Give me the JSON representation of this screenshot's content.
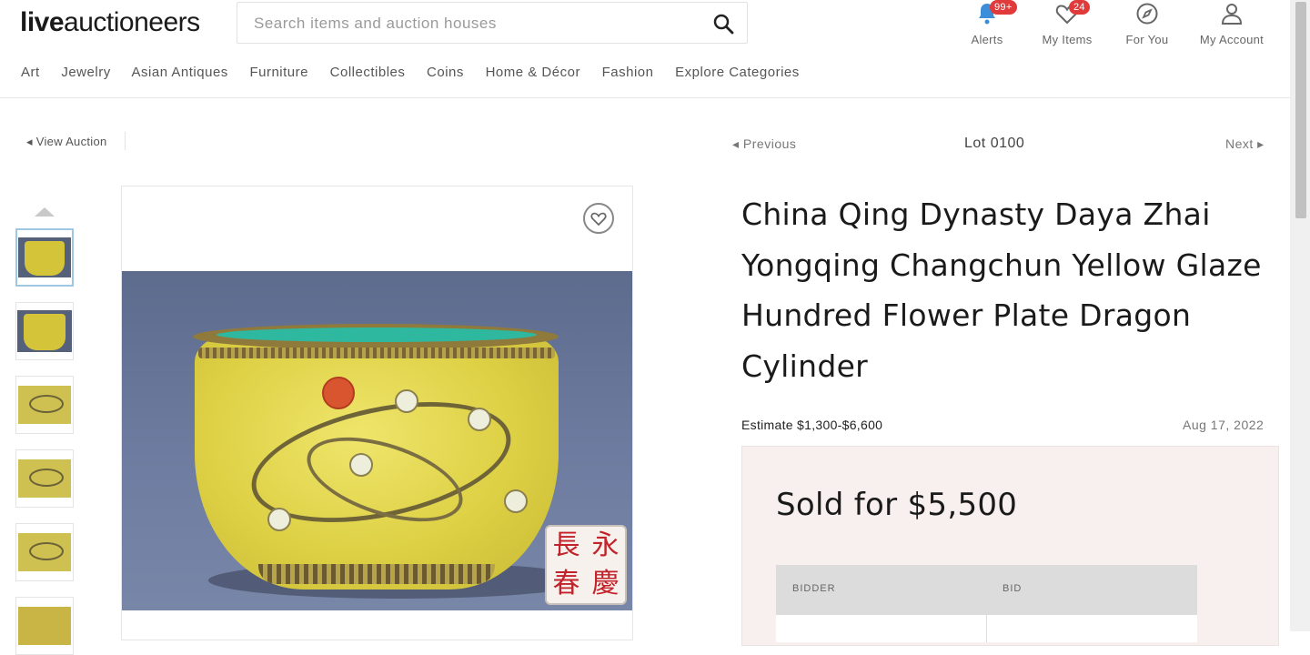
{
  "header": {
    "logo_bold": "live",
    "logo_rest": "auctioneers",
    "search_placeholder": "Search items and auction houses",
    "icons": [
      {
        "label": "Alerts",
        "badge": "99+",
        "icon": "bell-icon"
      },
      {
        "label": "My Items",
        "badge": "24",
        "icon": "heart-icon"
      },
      {
        "label": "For You",
        "icon": "compass-icon"
      },
      {
        "label": "My Account",
        "icon": "user-icon"
      }
    ],
    "nav": [
      "Art",
      "Jewelry",
      "Asian Antiques",
      "Furniture",
      "Collectibles",
      "Coins",
      "Home & Décor",
      "Fashion",
      "Explore Categories"
    ]
  },
  "lot_nav": {
    "view_auction": "View Auction",
    "previous": "Previous",
    "lot": "Lot 0100",
    "next": "Next"
  },
  "lot": {
    "title": "China Qing Dynasty Daya Zhai Yongqing Changchun Yellow Glaze Hundred Flower Plate Dragon Cylinder",
    "estimate": "Estimate $1,300-$6,600",
    "date": "Aug 17, 2022",
    "sold": "Sold for $5,500",
    "seal_chars": [
      "長",
      "永",
      "春",
      "慶"
    ]
  },
  "bid_table": {
    "columns": [
      "BIDDER",
      "BID"
    ]
  },
  "colors": {
    "badge": "#e03a3a",
    "sold_bg": "#f8efef",
    "table_header": "#dcdcdc",
    "active_thumb_border": "#9ec8e2"
  }
}
